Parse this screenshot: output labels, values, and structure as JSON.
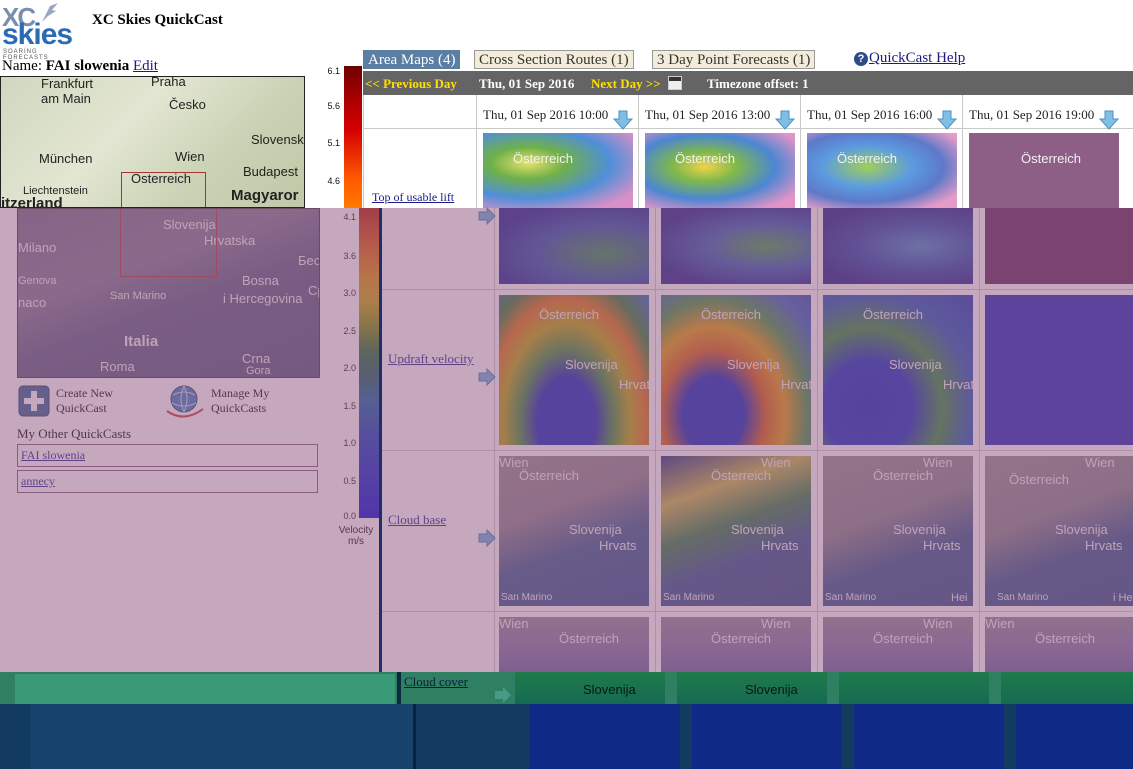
{
  "header": {
    "app_title": "XC Skies QuickCast",
    "logo": {
      "xc": "XC",
      "skies": "skies",
      "sub1": "SOARING",
      "sub2": "FORECASTS"
    },
    "name_label": "Name:",
    "name_value": "FAI slowenia",
    "edit_link": "Edit"
  },
  "tabs": [
    {
      "label": "Area Maps (4)",
      "active": true
    },
    {
      "label": "Cross Section Routes (1)",
      "active": false
    },
    {
      "label": "3 Day Point Forecasts (1)",
      "active": false
    }
  ],
  "help": {
    "label": "QuickCast Help",
    "icon": "question-icon"
  },
  "daybar": {
    "prev": "<< Previous Day",
    "date": "Thu, 01 Sep 2016",
    "next": "Next Day >>",
    "calendar_icon": "calendar-icon",
    "timezone": "Timezone offset: 1"
  },
  "columns": [
    "Thu, 01 Sep 2016 10:00",
    "Thu, 01 Sep 2016 13:00",
    "Thu, 01 Sep 2016 16:00",
    "Thu, 01 Sep 2016 19:00"
  ],
  "rows": [
    {
      "label": "Top of usable lift"
    },
    {
      "label": "Updraft velocity"
    },
    {
      "label": "Cloud base"
    },
    {
      "label": "Cloud cover"
    }
  ],
  "minimap": {
    "labels": [
      "Praha",
      "Frankfurt am Main",
      "Česko",
      "Slovensk",
      "München",
      "Wien",
      "Budapest",
      "Österreich",
      "Magyaror",
      "Liechtenstein",
      "itzerland"
    ],
    "labels2": [
      "Slovenija",
      "Hrvatska",
      "Milano",
      "Bosna",
      "i Hercegovina",
      "Genova",
      "Беог",
      "San Marino",
      "naco",
      "Italia",
      "Crna",
      "Gora",
      "Roma",
      "Cp"
    ]
  },
  "legend": {
    "top_ticks": [
      "6.1",
      "5.6",
      "5.1",
      "4.6"
    ],
    "ticks": [
      "4.1",
      "3.6",
      "3.0",
      "2.5",
      "2.0",
      "1.5",
      "1.0",
      "0.5",
      "0.0"
    ],
    "label": "Velocity",
    "unit": "m/s"
  },
  "controls": {
    "create_new": [
      "Create New",
      "QuickCast"
    ],
    "manage": [
      "Manage My",
      "QuickCasts"
    ]
  },
  "other_quickcasts": {
    "heading": "My Other QuickCasts",
    "items": [
      "FAI slowenia",
      "annecy"
    ]
  },
  "map_labels": {
    "wien": "Wien",
    "osterreich": "Österreich",
    "slovenija": "Slovenija",
    "hrvats": "Hrvats",
    "san_marino": "San Marino",
    "hei": "Hei",
    "ihe": "i He"
  },
  "colors": {
    "tab_active": "#5a7fa3",
    "tab_bg": "#f2ecd8",
    "daybar": "#646464",
    "daybar_link": "#ffe000",
    "overlay": "#955f87"
  }
}
